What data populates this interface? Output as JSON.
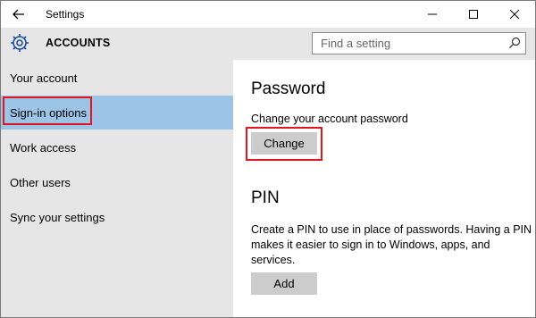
{
  "titlebar": {
    "title": "Settings"
  },
  "header": {
    "section_title": "ACCOUNTS",
    "search_placeholder": "Find a setting"
  },
  "sidebar": {
    "items": [
      {
        "label": "Your account"
      },
      {
        "label": "Sign-in options",
        "selected": true
      },
      {
        "label": "Work access"
      },
      {
        "label": "Other users"
      },
      {
        "label": "Sync your settings"
      }
    ]
  },
  "main": {
    "password": {
      "heading": "Password",
      "description": "Change your account password",
      "button": "Change"
    },
    "pin": {
      "heading": "PIN",
      "description": "Create a PIN to use in place of passwords. Having a PIN makes it easier to sign in to Windows, apps, and services.",
      "button": "Add"
    }
  },
  "colors": {
    "selected": "#9cc4e6",
    "highlight": "#e0171f",
    "sidebar_bg": "#e6e6e6",
    "button_bg": "#cccccc"
  },
  "icons": {
    "back": "back-arrow-icon",
    "settings": "gear-icon",
    "search": "search-icon"
  }
}
